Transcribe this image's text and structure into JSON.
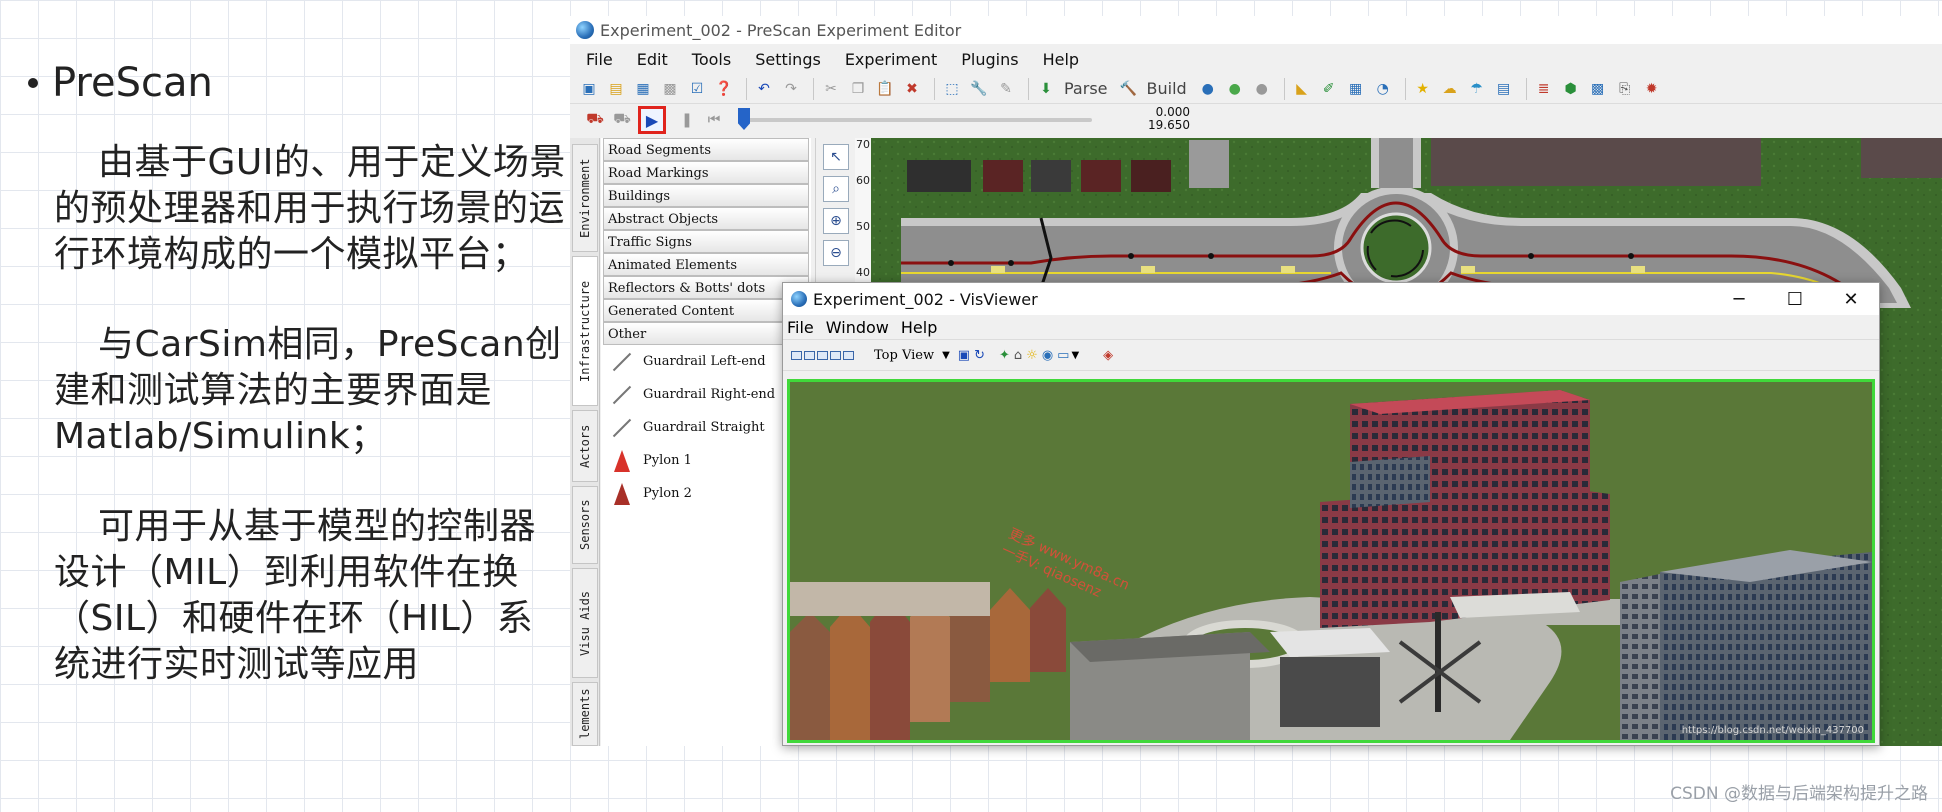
{
  "slide": {
    "heading": "PreScan",
    "paragraphs": [
      "由基于GUI的、用于定义场景的预处理器和用于执行场景的运行环境构成的一个模拟平台；",
      "与CarSim相同，PreScan创建和测试算法的主要界面是Matlab/Simulink；",
      "可用于从基于模型的控制器设计（MIL）到利用软件在换（SIL）和硬件在环（HIL）系统进行实时测试等应用"
    ],
    "watermark": "CSDN @数据与后端架构提升之路"
  },
  "editor": {
    "title": "Experiment_002 - PreScan Experiment Editor",
    "menu": [
      "File",
      "Edit",
      "Tools",
      "Settings",
      "Experiment",
      "Plugins",
      "Help"
    ],
    "toolbar": {
      "parse": "Parse",
      "build": "Build"
    },
    "sim": {
      "time_start": "0.000",
      "time_end": "19.650",
      "progress": 0.0
    },
    "vertical_tabs": [
      "Environment",
      "Infrastructure",
      "Actors",
      "Sensors",
      "Visu Aids",
      "lements"
    ],
    "library_categories": [
      "Road Segments",
      "Road Markings",
      "Buildings",
      "Abstract Objects",
      "Traffic Signs",
      "Animated Elements",
      "Reflectors & Botts' dots",
      "Generated Content",
      "Other"
    ],
    "library_items": [
      {
        "label": "Guardrail Left-end",
        "icon": "guardrail-icon"
      },
      {
        "label": "Guardrail Right-end",
        "icon": "guardrail-icon"
      },
      {
        "label": "Guardrail Straight",
        "icon": "guardrail-icon"
      },
      {
        "label": "Pylon 1",
        "icon": "pylon-icon"
      },
      {
        "label": "Pylon 2",
        "icon": "pylon-icon"
      }
    ],
    "ruler": [
      "70",
      "60",
      "50",
      "40"
    ],
    "colors": {
      "play_highlight": "#e0241d",
      "selection_border": "#40d83a"
    }
  },
  "visviewer": {
    "title": "Experiment_002 - VisViewer",
    "menu": [
      "File",
      "Window",
      "Help"
    ],
    "view": "Top View",
    "window_controls": [
      "─",
      "☐",
      "✕"
    ],
    "red_watermark": [
      "更多 www.ym8a.cn",
      "一手V: qiaosenz"
    ],
    "scene_credit": "https://blog.csdn.net/weixin_437700"
  }
}
